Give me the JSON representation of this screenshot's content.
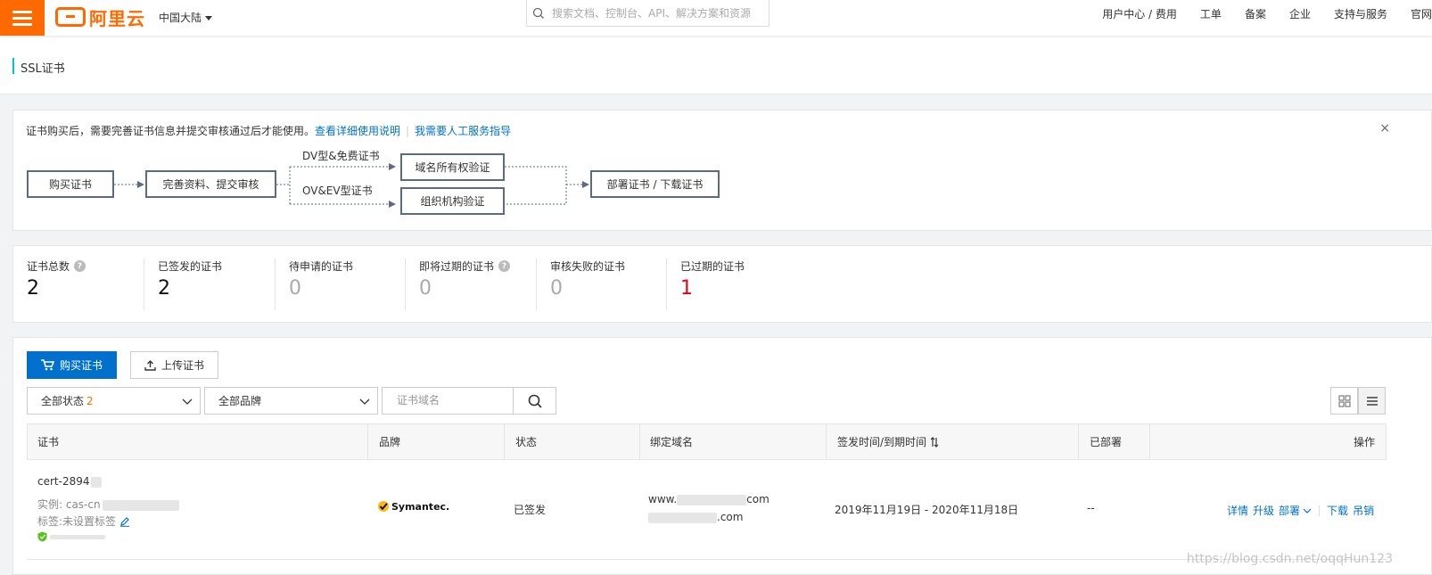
{
  "topbar": {
    "brand": "阿里云",
    "region": "中国大陆",
    "search_placeholder": "搜索文档、控制台、API、解决方案和资源",
    "nav_items": [
      "用户中心 / 费用",
      "工单",
      "备案",
      "企业",
      "支持与服务",
      "官网"
    ]
  },
  "page": {
    "title": "SSL证书"
  },
  "notice": {
    "message": "证书购买后，需要完善证书信息并提交审核通过后才能使用。",
    "link1": "查看详细使用说明",
    "link2": "我需要人工服务指导",
    "close": "×"
  },
  "flow": {
    "step1": "购买证书",
    "step2": "完善资料、提交审核",
    "branch_dv_label": "DV型&免费证书",
    "branch_ov_label": "OV&EV型证书",
    "step_domain": "域名所有权验证",
    "step_org": "组织机构验证",
    "step_final": "部署证书 / 下载证书"
  },
  "stats": [
    {
      "label": "证书总数",
      "value": "2",
      "help": true
    },
    {
      "label": "已签发的证书",
      "value": "2"
    },
    {
      "label": "待申请的证书",
      "value": "0"
    },
    {
      "label": "即将过期的证书",
      "value": "0",
      "help": true
    },
    {
      "label": "审核失败的证书",
      "value": "0"
    },
    {
      "label": "已过期的证书",
      "value": "1",
      "color": "#e60012"
    }
  ],
  "toolbar": {
    "buy_label": "购买证书",
    "upload_label": "上传证书",
    "status_filter": "全部状态",
    "status_count": "2",
    "brand_filter": "全部品牌",
    "search_placeholder": "证书域名"
  },
  "table": {
    "columns": [
      "证书",
      "品牌",
      "状态",
      "绑定域名",
      "签发时间/到期时间",
      "已部署",
      "操作"
    ],
    "rows": [
      {
        "cert_name": "cert-2894",
        "instance_label": "实例: cas-cn",
        "tag_label": "标签:未设置标签",
        "brand": "Symantec.",
        "status": "已签发",
        "domain_line1_prefix": "www.",
        "domain_line1_suffix": "com",
        "domain_line2_suffix": ".com",
        "dates": "2019年11月19日 - 2020年11月18日",
        "deployed": "--",
        "actions": [
          "详情",
          "升级",
          "部署",
          "下载",
          "吊销"
        ]
      }
    ]
  },
  "watermark": "https://blog.csdn.net/oqqHun123"
}
